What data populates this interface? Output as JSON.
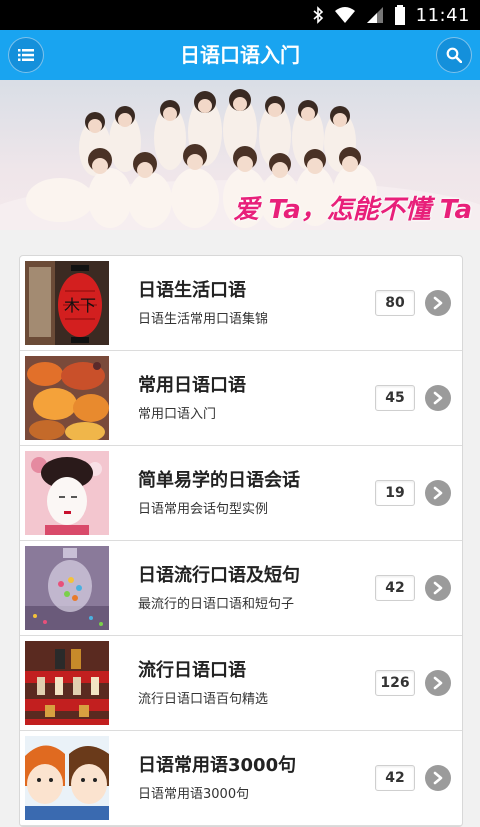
{
  "status_bar": {
    "time": "11:41"
  },
  "app_bar": {
    "title": "日语口语入门"
  },
  "banner": {
    "caption": "爱 Ta，怎能不懂 Ta"
  },
  "lessons": [
    {
      "title": "日语生活口语",
      "subtitle": "日语生活常用口语集锦",
      "count": "80"
    },
    {
      "title": "常用日语口语",
      "subtitle": "常用口语入门",
      "count": "45"
    },
    {
      "title": "简单易学的日语会话",
      "subtitle": "日语常用会话句型实例",
      "count": "19"
    },
    {
      "title": "日语流行口语及短句",
      "subtitle": "最流行的日语口语和短句子",
      "count": "42"
    },
    {
      "title": "流行日语口语",
      "subtitle": "流行日语口语百句精选",
      "count": "126"
    },
    {
      "title": "日语常用语3000句",
      "subtitle": "日语常用语3000句",
      "count": "42"
    }
  ],
  "colors": {
    "app_bar": "#19a4f0",
    "banner_caption": "#e8207a"
  }
}
